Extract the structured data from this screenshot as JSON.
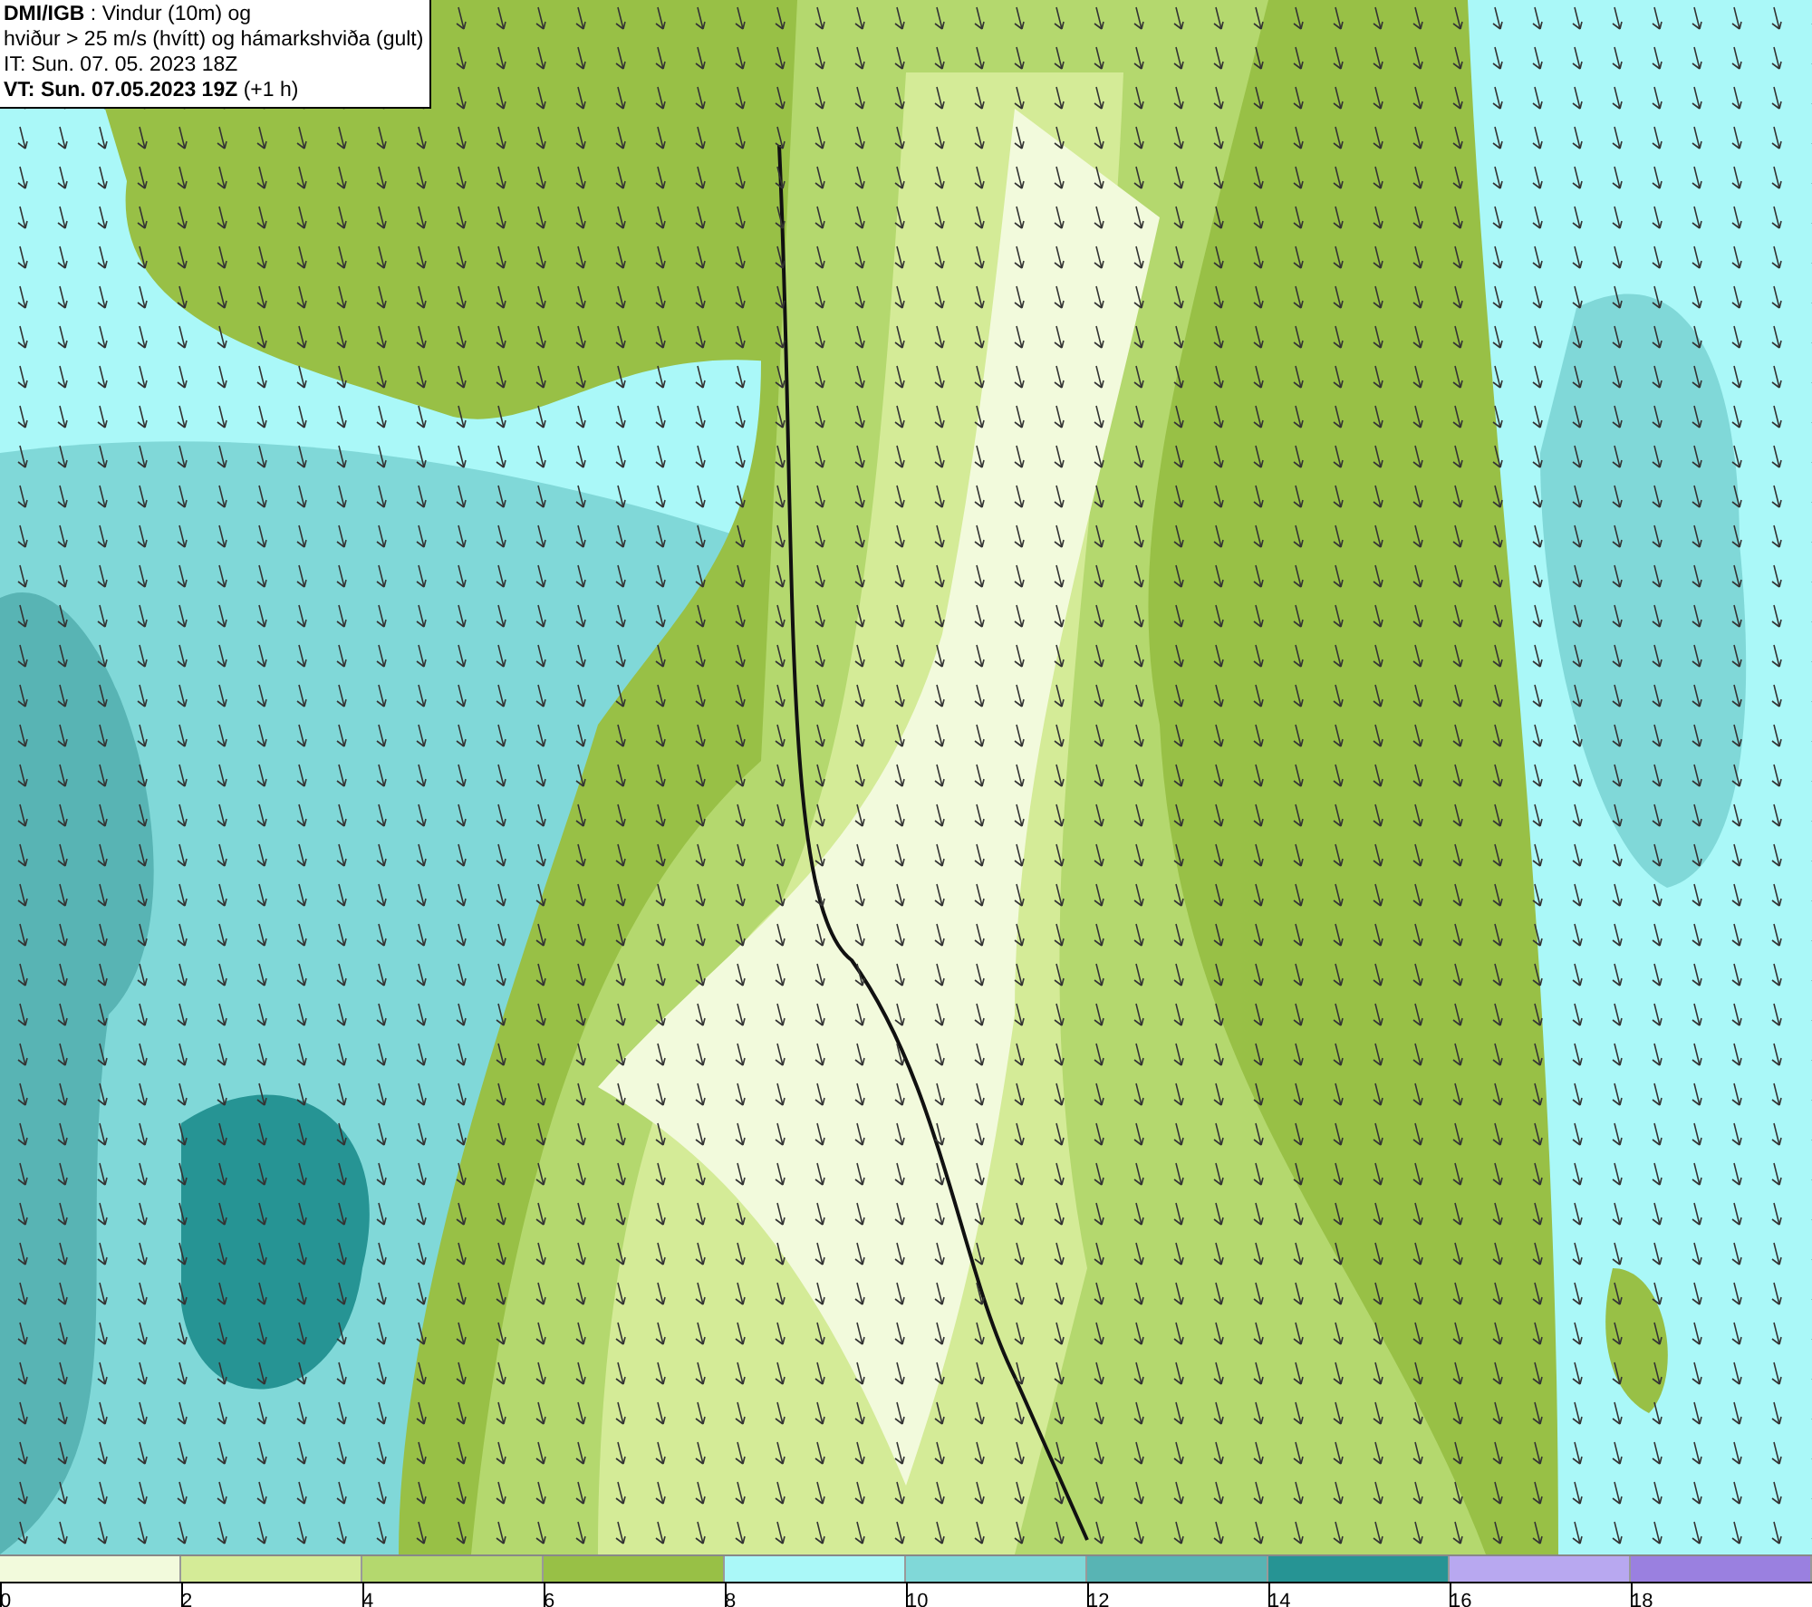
{
  "info_box": {
    "lines": [
      "**DMI/IGB** : Vindur (10m) og",
      "hviður > 25 m/s (hvítt) og hámarkshviða (gult)",
      "IT: Sun. 07. 05. 2023 18Z",
      "**VT: Sun. 07.05.2023 19Z** (+1 h)"
    ]
  },
  "legend": {
    "bins": [
      {
        "color": "#f2fadc"
      },
      {
        "color": "#d4eb97"
      },
      {
        "color": "#b4d86e"
      },
      {
        "color": "#98c046"
      },
      {
        "color": "#aaf8f8"
      },
      {
        "color": "#80d8d8"
      },
      {
        "color": "#58b4b4"
      },
      {
        "color": "#269494"
      },
      {
        "color": "#b8a8f0"
      },
      {
        "color": "#9a80e0"
      }
    ],
    "ticks": [
      "0",
      "2",
      "4",
      "6",
      "8",
      "10",
      "12",
      "14",
      "16",
      "18"
    ]
  }
}
